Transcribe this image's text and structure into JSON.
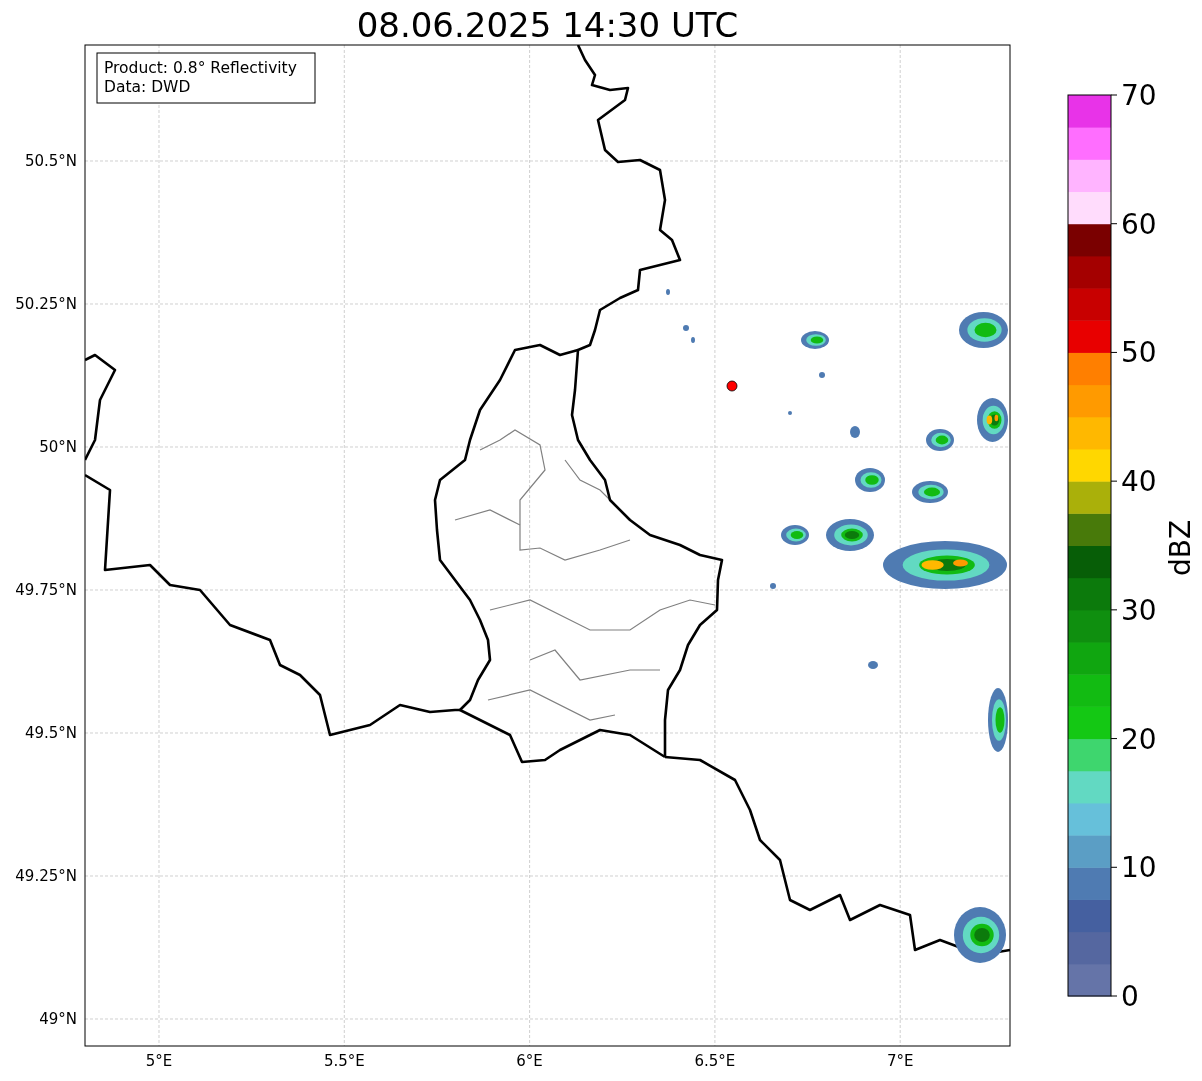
{
  "title": "08.06.2025 14:30 UTC",
  "info_box": [
    "Product: 0.8° Reflectivity",
    "Data: DWD"
  ],
  "map": {
    "lat_labels": [
      "50.5°N",
      "50.25°N",
      "50°N",
      "49.75°N",
      "49.5°N",
      "49.25°N",
      "49°N"
    ],
    "lon_labels": [
      "5°E",
      "5.5°E",
      "6°E",
      "6.5°E",
      "7°E"
    ]
  },
  "colorbar": {
    "label": "dBZ",
    "ticks": [
      "70",
      "60",
      "50",
      "40",
      "30",
      "20",
      "10",
      "0"
    ]
  }
}
